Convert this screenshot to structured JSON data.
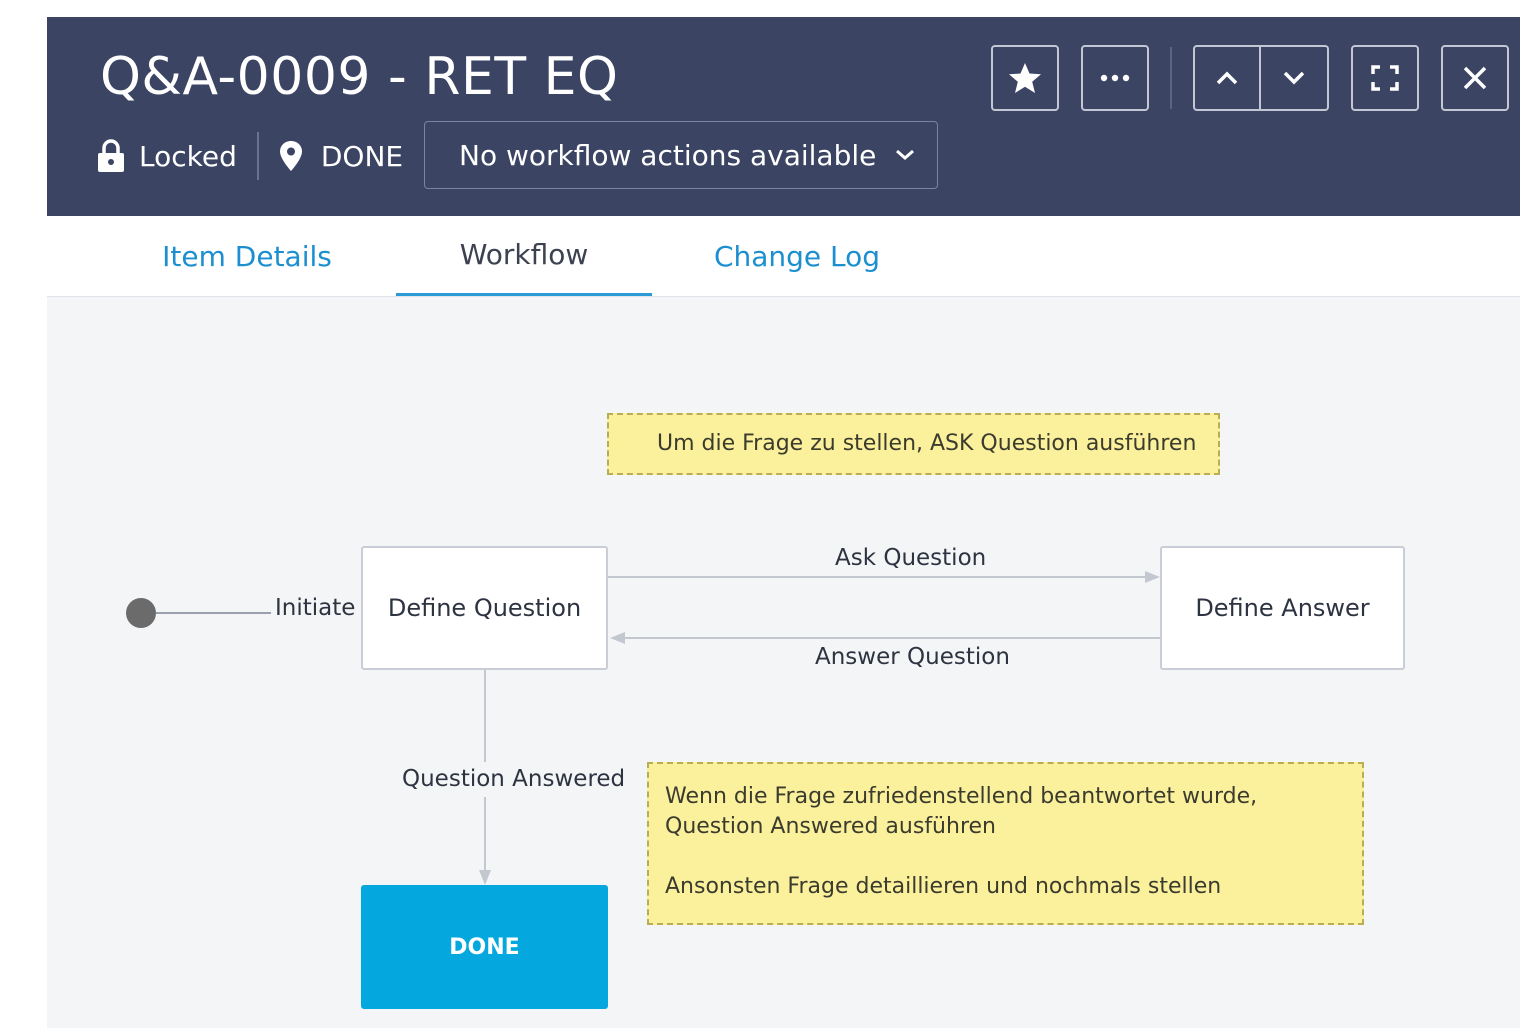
{
  "header": {
    "title": "Q&A-0009 - RET EQ",
    "lock_status": "Locked",
    "state": "DONE",
    "workflow_actions": "No workflow actions available",
    "buttons": [
      "favorite",
      "more",
      "previous",
      "next",
      "fullscreen",
      "close"
    ]
  },
  "tabs": [
    {
      "label": "Item Details",
      "active": false
    },
    {
      "label": "Workflow",
      "active": true
    },
    {
      "label": "Change Log",
      "active": false
    }
  ],
  "workflow": {
    "start_transition": "Initiate",
    "states": {
      "define_question": "Define Question",
      "define_answer": "Define Answer",
      "done": "DONE"
    },
    "transitions": {
      "ask": "Ask Question",
      "answer": "Answer Question",
      "answered": "Question Answered"
    },
    "notes": {
      "top": "Um die Frage zu stellen, ASK Question ausführen",
      "bottom_line1": "Wenn die Frage zufriedenstellend beantwortet wurde, Question Answered ausführen",
      "bottom_line2": "Ansonsten Frage detaillieren und nochmals stellen"
    }
  },
  "colors": {
    "header_bg": "#3b4463",
    "accent": "#04a8de",
    "tab_link": "#1c8fd0",
    "note_bg": "#fbf19d"
  }
}
